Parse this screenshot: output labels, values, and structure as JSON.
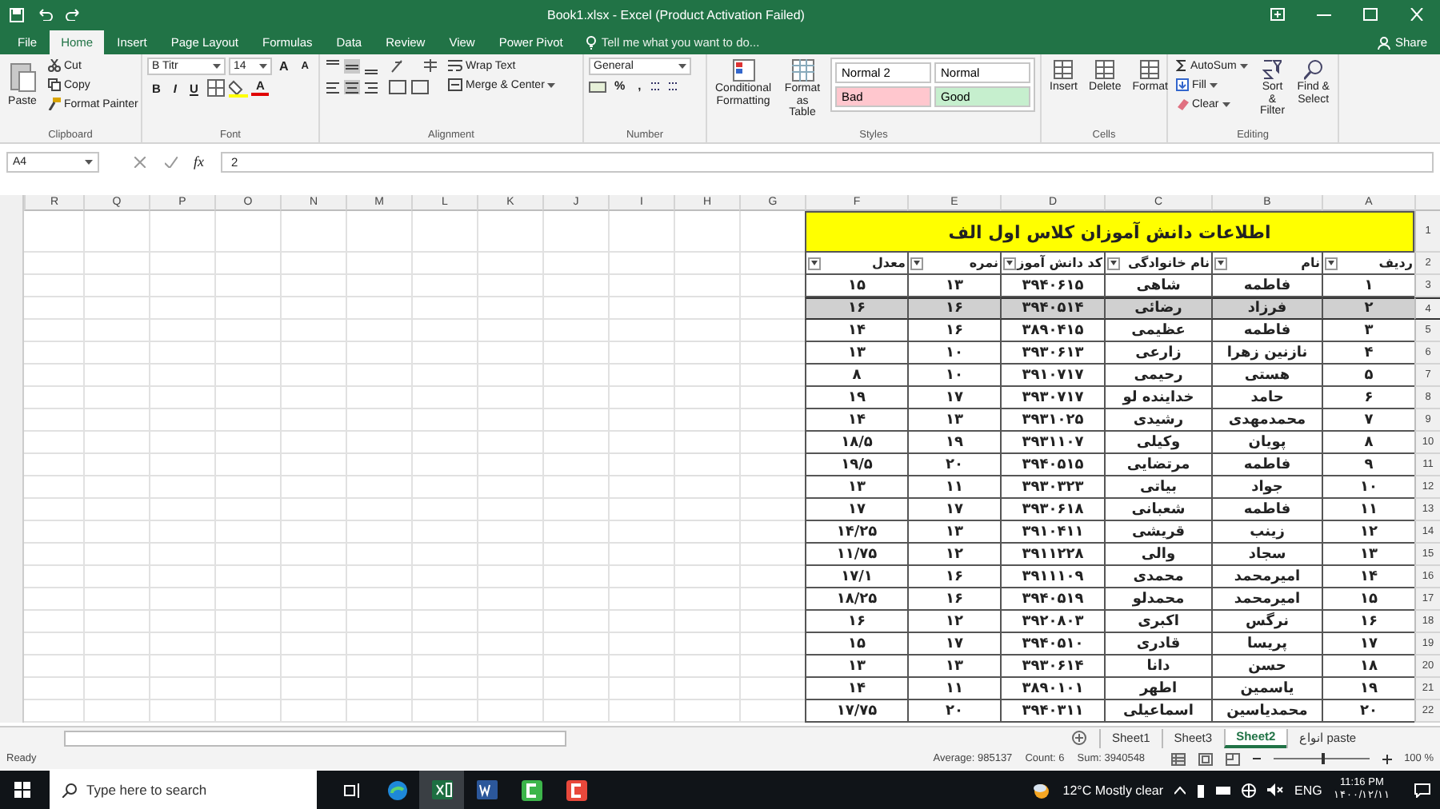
{
  "window": {
    "title": "Book1.xlsx - Excel (Product Activation Failed)"
  },
  "ribbon_tabs": [
    {
      "label": "Power Pivot",
      "selected": false
    },
    {
      "label": "View",
      "selected": false
    },
    {
      "label": "Review",
      "selected": false
    },
    {
      "label": "Data",
      "selected": false
    },
    {
      "label": "Formulas",
      "selected": false
    },
    {
      "label": "Page Layout",
      "selected": false
    },
    {
      "label": "Insert",
      "selected": false
    },
    {
      "label": "Home",
      "selected": true
    },
    {
      "label": "File",
      "selected": false
    }
  ],
  "tell_me": {
    "placeholder": "Tell me what you want to do..."
  },
  "share": "Share",
  "clipboard": {
    "label": "Clipboard",
    "paste": "Paste",
    "cut": "Cut",
    "copy": "Copy",
    "format_painter": "Format Painter"
  },
  "font": {
    "label": "Font",
    "name": "B Titr",
    "size": "14",
    "grow": "A",
    "shrink": "A",
    "bold": "B",
    "italic": "I",
    "underline": "U",
    "font_color": "A"
  },
  "alignment": {
    "label": "Alignment",
    "wrap_text": "Wrap Text",
    "merge_center": "Merge & Center"
  },
  "number": {
    "label": "Number",
    "format": "General",
    "percent": "%",
    "comma": ","
  },
  "styles": {
    "label": "Styles",
    "conditional_formatting": "Conditional Formatting",
    "format_as_table": "Format as Table",
    "cell_styles": [
      {
        "label": "Normal",
        "color": "#ffffff"
      },
      {
        "label": "Normal 2",
        "color": "#ffffff"
      },
      {
        "label": "Good",
        "color": "#c6efce"
      },
      {
        "label": "Bad",
        "color": "#ffc7ce"
      }
    ]
  },
  "cells": {
    "label": "Cells",
    "buttons": [
      "Format",
      "Delete",
      "Insert"
    ]
  },
  "editing": {
    "label": "Editing",
    "autosum": "AutoSum",
    "fill": "Fill",
    "clear": "Clear",
    "sort_filter": "Sort & Filter",
    "find_select": "Find & Select"
  },
  "formula_bar": {
    "name_box": "A4",
    "fx": "fx",
    "value": "2"
  },
  "sheet": {
    "columns": [
      "A",
      "B",
      "C",
      "D",
      "E",
      "F",
      "G",
      "H",
      "I",
      "J",
      "K",
      "L",
      "M",
      "N",
      "O",
      "P",
      "Q",
      "R"
    ],
    "title_row": {
      "number": "1",
      "title": "اطلاعات دانش آموزان کلاس اول الف"
    },
    "header_row": {
      "number": "2",
      "headers": [
        "ردیف",
        "نام",
        "نام خانوادگی",
        "کد دانش آموز",
        "نمره",
        "معدل"
      ]
    },
    "rows": [
      {
        "number": "3",
        "selected": false,
        "cells": [
          "۱",
          "فاطمه",
          "شاهی",
          "۳۹۴۰۶۱۵",
          "۱۳",
          "۱۵"
        ]
      },
      {
        "number": "4",
        "selected": true,
        "cells": [
          "۲",
          "فرزاد",
          "رضائی",
          "۳۹۴۰۵۱۴",
          "۱۶",
          "۱۶"
        ]
      },
      {
        "number": "5",
        "selected": false,
        "cells": [
          "۳",
          "فاطمه",
          "عظیمی",
          "۳۸۹۰۴۱۵",
          "۱۶",
          "۱۴"
        ]
      },
      {
        "number": "6",
        "selected": false,
        "cells": [
          "۴",
          "نازنین زهرا",
          "زارعی",
          "۳۹۳۰۶۱۳",
          "۱۰",
          "۱۳"
        ]
      },
      {
        "number": "7",
        "selected": false,
        "cells": [
          "۵",
          "هستی",
          "رحیمی",
          "۳۹۱۰۷۱۷",
          "۱۰",
          "۸"
        ]
      },
      {
        "number": "8",
        "selected": false,
        "cells": [
          "۶",
          "حامد",
          "خداینده لو",
          "۳۹۳۰۷۱۷",
          "۱۷",
          "۱۹"
        ]
      },
      {
        "number": "9",
        "selected": false,
        "cells": [
          "۷",
          "محمدمهدی",
          "رشیدی",
          "۳۹۳۱۰۲۵",
          "۱۳",
          "۱۴"
        ]
      },
      {
        "number": "10",
        "selected": false,
        "cells": [
          "۸",
          "پویان",
          "وکیلی",
          "۳۹۳۱۱۰۷",
          "۱۹",
          "۱۸/۵"
        ]
      },
      {
        "number": "11",
        "selected": false,
        "cells": [
          "۹",
          "فاطمه",
          "مرتضایی",
          "۳۹۴۰۵۱۵",
          "۲۰",
          "۱۹/۵"
        ]
      },
      {
        "number": "12",
        "selected": false,
        "cells": [
          "۱۰",
          "جواد",
          "بیاتی",
          "۳۹۳۰۳۲۳",
          "۱۱",
          "۱۳"
        ]
      },
      {
        "number": "13",
        "selected": false,
        "cells": [
          "۱۱",
          "فاطمه",
          "شعبانی",
          "۳۹۳۰۶۱۸",
          "۱۷",
          "۱۷"
        ]
      },
      {
        "number": "14",
        "selected": false,
        "cells": [
          "۱۲",
          "زینب",
          "قریشی",
          "۳۹۱۰۴۱۱",
          "۱۳",
          "۱۴/۲۵"
        ]
      },
      {
        "number": "15",
        "selected": false,
        "cells": [
          "۱۳",
          "سجاد",
          "والی",
          "۳۹۱۱۲۲۸",
          "۱۲",
          "۱۱/۷۵"
        ]
      },
      {
        "number": "16",
        "selected": false,
        "cells": [
          "۱۴",
          "امیرمحمد",
          "محمدی",
          "۳۹۱۱۱۰۹",
          "۱۶",
          "۱۷/۱"
        ]
      },
      {
        "number": "17",
        "selected": false,
        "cells": [
          "۱۵",
          "امیرمحمد",
          "محمدلو",
          "۳۹۴۰۵۱۹",
          "۱۶",
          "۱۸/۲۵"
        ]
      },
      {
        "number": "18",
        "selected": false,
        "cells": [
          "۱۶",
          "نرگس",
          "اکبری",
          "۳۹۲۰۸۰۳",
          "۱۲",
          "۱۶"
        ]
      },
      {
        "number": "19",
        "selected": false,
        "cells": [
          "۱۷",
          "پریسا",
          "قادری",
          "۳۹۴۰۵۱۰",
          "۱۷",
          "۱۵"
        ]
      },
      {
        "number": "20",
        "selected": false,
        "cells": [
          "۱۸",
          "حسن",
          "دانا",
          "۳۹۳۰۶۱۴",
          "۱۳",
          "۱۳"
        ]
      },
      {
        "number": "21",
        "selected": false,
        "cells": [
          "۱۹",
          "یاسمین",
          "اطهر",
          "۳۸۹۰۱۰۱",
          "۱۱",
          "۱۴"
        ]
      },
      {
        "number": "22",
        "selected": false,
        "cells": [
          "۲۰",
          "محمدیاسین",
          "اسماعیلی",
          "۳۹۴۰۳۱۱",
          "۲۰",
          "۱۷/۷۵"
        ]
      }
    ]
  },
  "sheet_tabs": [
    {
      "label": "انواع paste",
      "selected": false
    },
    {
      "label": "Sheet2",
      "selected": true
    },
    {
      "label": "Sheet3",
      "selected": false
    },
    {
      "label": "Sheet1",
      "selected": false
    }
  ],
  "status_bar": {
    "ready": "Ready",
    "average": "Average: 985137",
    "count": "Count: 6",
    "sum": "Sum: 3940548",
    "zoom_slider": {
      "level": 0.5
    },
    "zoom": "100 %"
  },
  "taskbar": {
    "search": {
      "placeholder": "Type here to search"
    },
    "weather": "12°C Mostly clear",
    "language": "ENG",
    "time": "11:16 PM",
    "date": "۱۴۰۰/۱۲/۱۱"
  }
}
